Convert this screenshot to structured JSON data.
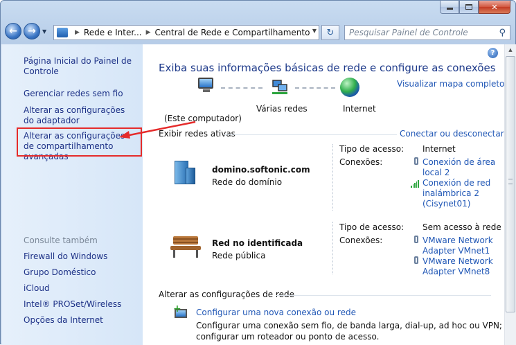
{
  "window": {
    "buttons": {
      "minimize": "minimize",
      "maximize": "maximize",
      "close": "✕"
    }
  },
  "nav": {
    "back_icon": "back-arrow-icon",
    "forward_icon": "forward-arrow-icon",
    "breadcrumb": [
      "Rede e Inter...",
      "Central de Rede e Compartilhamento"
    ],
    "search_placeholder": "Pesquisar Painel de Controle"
  },
  "sidebar": {
    "items": [
      {
        "label": "Página Inicial do Painel de Controle"
      },
      {
        "label": "Gerenciar redes sem fio"
      },
      {
        "label": "Alterar as configurações do adaptador"
      },
      {
        "label": "Alterar as configurações de compartilhamento avançadas"
      }
    ],
    "see_also_title": "Consulte também",
    "see_also": [
      {
        "label": "Firewall do Windows"
      },
      {
        "label": "Grupo Doméstico"
      },
      {
        "label": "iCloud"
      },
      {
        "label": "Intel® PROSet/Wireless"
      },
      {
        "label": "Opções da Internet"
      }
    ]
  },
  "main": {
    "heading": "Exiba suas informações básicas de rede e configure as conexões",
    "view_map_link": "Visualizar mapa completo",
    "map": {
      "computer_label": "(Este computador)",
      "networks_label": "Várias redes",
      "internet_label": "Internet"
    },
    "active_title": "Exibir redes ativas",
    "connect_link": "Conectar ou desconectar",
    "networks": [
      {
        "name": "domino.softonic.com",
        "type": "Rede do domínio",
        "access_label": "Tipo de acesso:",
        "access_value": "Internet",
        "connections_label": "Conexões:",
        "connections": [
          {
            "line1": "Conexión de área",
            "line2": "local 2"
          },
          {
            "line1": "Conexión de red",
            "line2": "inalámbrica 2",
            "line3": "(Cisynet01)"
          }
        ]
      },
      {
        "name": "Red no identificada",
        "type": "Rede pública",
        "access_label": "Tipo de acesso:",
        "access_value": "Sem acesso à rede",
        "connections_label": "Conexões:",
        "connections": [
          {
            "line1": "VMware Network",
            "line2": "Adapter VMnet1"
          },
          {
            "line1": "VMware Network",
            "line2": "Adapter VMnet8"
          }
        ]
      }
    ],
    "change_title": "Alterar as configurações de rede",
    "new_conn_link": "Configurar uma nova conexão ou rede",
    "new_conn_desc1": "Configurar uma conexão sem fio, de banda larga, dial-up, ad hoc ou VPN; ou",
    "new_conn_desc2": "configurar um roteador ou ponto de acesso."
  },
  "annotation": {
    "arrow_color": "#e52b2b",
    "box_color": "#e52b2b"
  }
}
